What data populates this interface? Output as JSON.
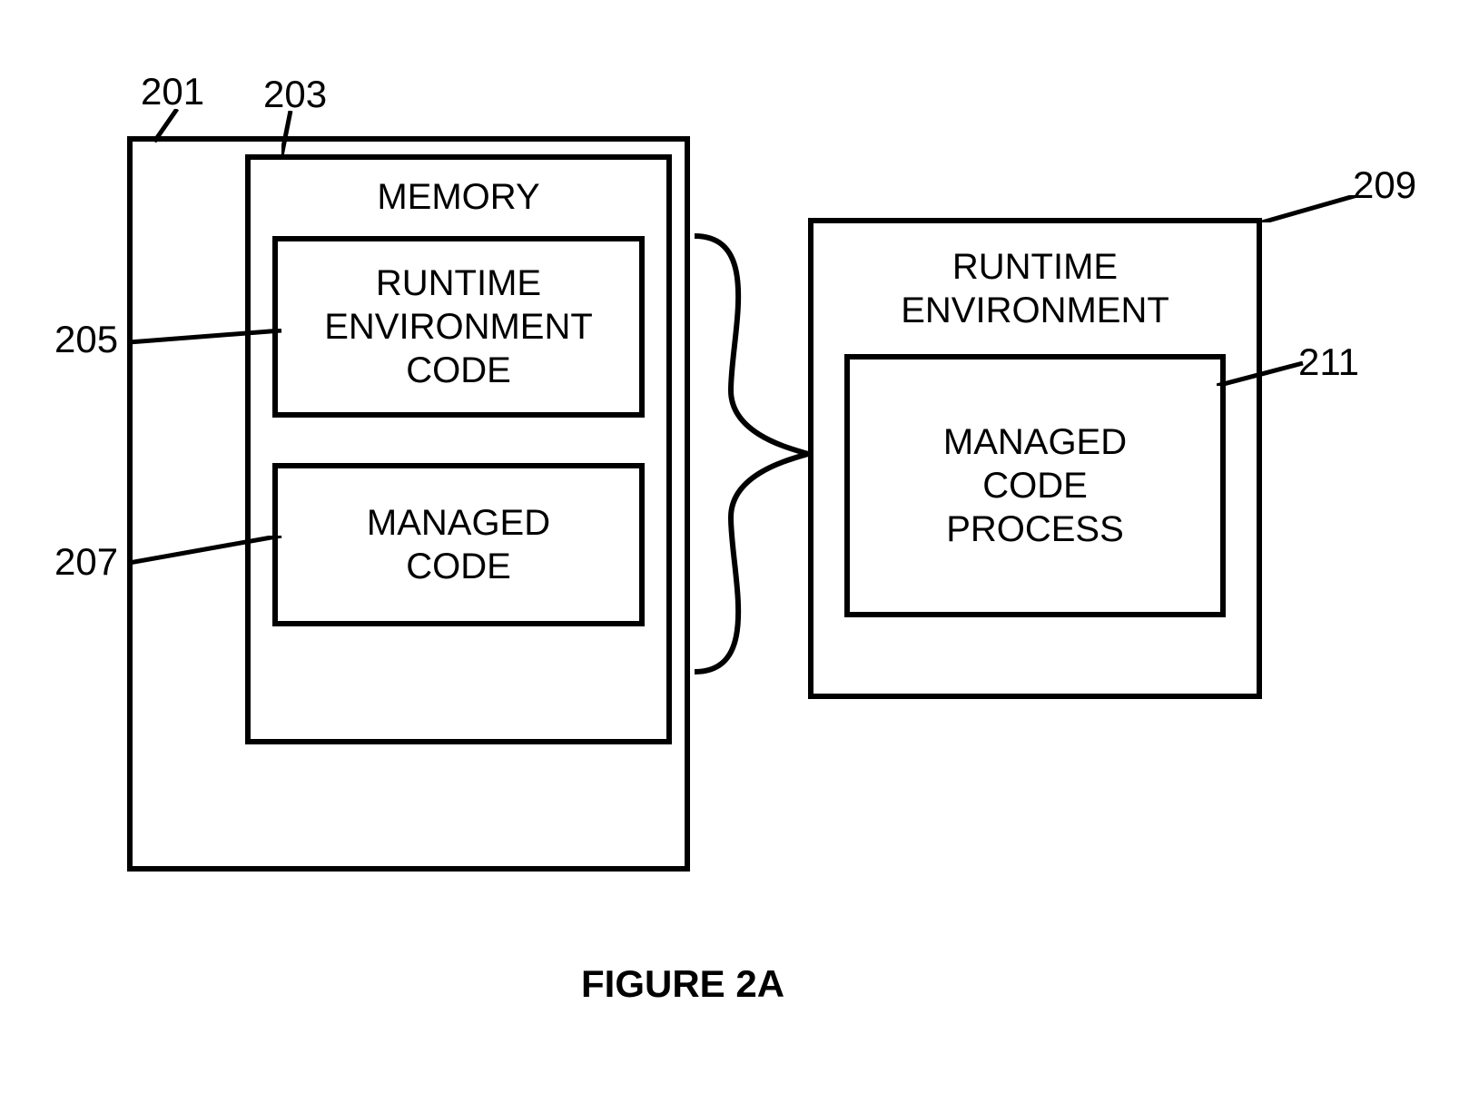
{
  "labels": {
    "ref_201": "201",
    "ref_203": "203",
    "ref_205": "205",
    "ref_207": "207",
    "ref_209": "209",
    "ref_211": "211"
  },
  "boxes": {
    "memory_title": "MEMORY",
    "runtime_env_code": "RUNTIME ENVIRONMENT CODE",
    "managed_code": "MANAGED CODE",
    "runtime_env": "RUNTIME ENVIRONMENT",
    "managed_code_process": "MANAGED CODE PROCESS"
  },
  "caption": "FIGURE 2A"
}
